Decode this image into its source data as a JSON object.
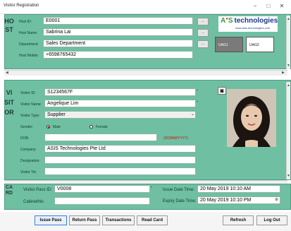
{
  "window": {
    "title": "Visitor Registration",
    "minimize": "−",
    "maximize": "□",
    "close": "✕"
  },
  "host": {
    "section_letters": "HOST",
    "fields": [
      {
        "label": "Host ID:",
        "value": "E0001"
      },
      {
        "label": "Host Name:",
        "value": "Sabrina Lai"
      },
      {
        "label": "Department:",
        "value": "Sales Department"
      },
      {
        "label": "Host Mobile:",
        "value": "+6598765432"
      }
    ],
    "lookup_button": "...",
    "logo": {
      "brand": "A S technologies",
      "brand_prefix": "A",
      "brand_mid": "S",
      "brand_rest": "technologies",
      "url": "www.asis-technologies.com"
    },
    "uag": [
      "UAG1",
      "UAG2"
    ]
  },
  "visitor": {
    "section_letters": "VISITOR",
    "visitor_id_label": "Visitor ID:",
    "visitor_id": "S1234567F",
    "visitor_name_label": "Visitor Name:",
    "visitor_name": "Angelique Lim",
    "visitor_type_label": "Visitor Type:",
    "visitor_type": "Supplier",
    "gender_label": "Gender:",
    "gender_male": "Male",
    "gender_female": "Female",
    "gender_selected": "Male",
    "dob_label": "DOB:",
    "dob_value": "",
    "dob_hint": "(DD/MM/YYYY)",
    "company_label": "Company:",
    "company": "ASIS Technologies Pte Ltd",
    "designation_label": "Designation:",
    "designation": "",
    "visitor_tel_label": "Visitor Tel:",
    "visitor_tel": "",
    "camera_icon": "camera-icon"
  },
  "card": {
    "section_letters": "CARD",
    "pass_id_label": "Visitor Pass ID:",
    "pass_id": "V0008",
    "cabinet_label": "CabinetNo:",
    "cabinet": "",
    "issue_label": "Issue Date Time:",
    "issue_value": "20 May 2019 10:10 AM",
    "expiry_label": "Expiry Date Time:",
    "expiry_value": "20 May 2019 10:10 PM",
    "expiry_icon": "calendar-dropdown-icon"
  },
  "buttons": {
    "issue_pass": "Issue Pass",
    "return_pass": "Return Pass",
    "transactions": "Transactions",
    "read_card": "Read Card",
    "refresh": "Refresh",
    "log_out": "Log Out"
  },
  "colors": {
    "section_bg": "#6fbfa2",
    "logo_green": "#2f9b3a",
    "logo_blue": "#1a3a8c",
    "hint_red": "#d01010"
  }
}
